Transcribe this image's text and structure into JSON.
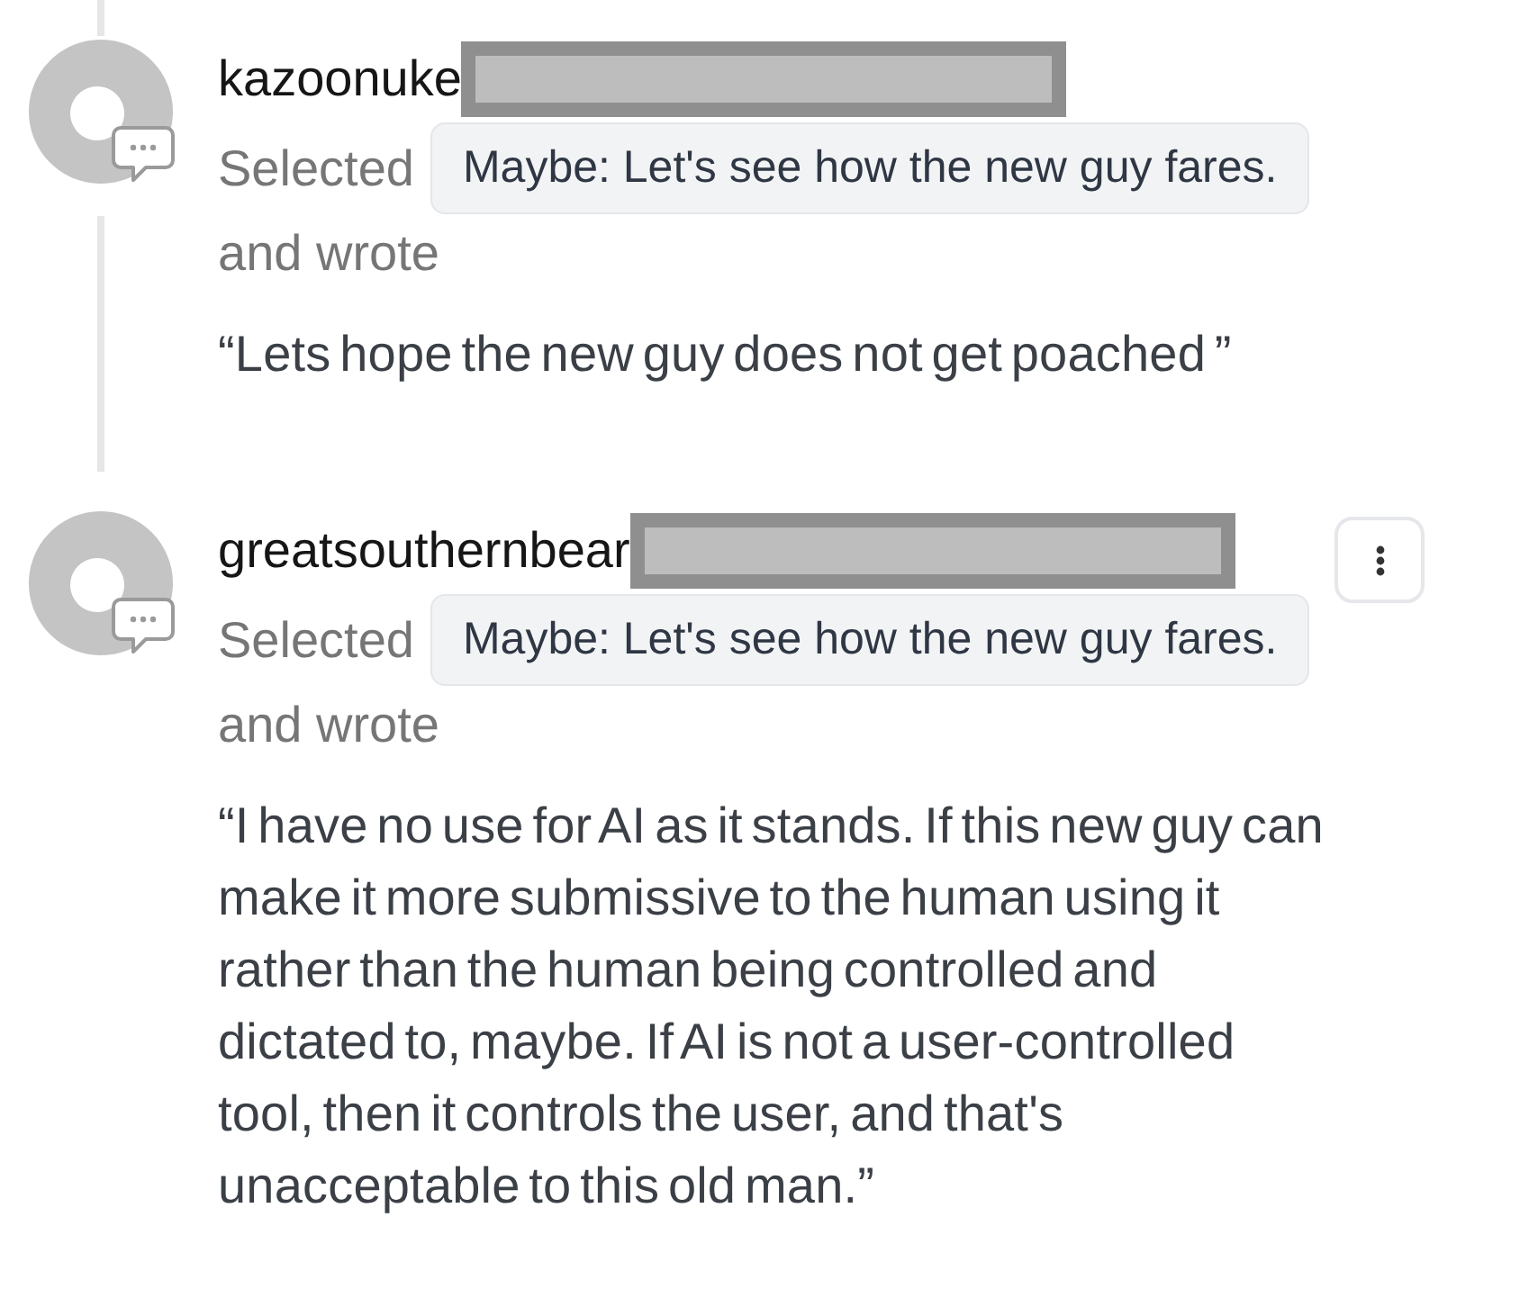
{
  "comments": [
    {
      "username": "kazoonuke",
      "redacted": true,
      "action": "Selected",
      "choice": "Maybe: Let's see how the new guy fares.",
      "connector": "and wrote",
      "text": "“Lets hope the new guy does not get poached ”",
      "menu": false,
      "line_above": true,
      "line_below": true
    },
    {
      "username": "greatsouthernbear",
      "redacted": true,
      "action": "Selected",
      "choice": "Maybe: Let's see how the new guy fares.",
      "connector": "and wrote",
      "text": "“I have no use for AI as it stands. If this new guy can make it more submissive to the human using it rather than the human being controlled and dictated to, maybe. If AI is not a user-controlled tool, then it controls the user, and that's unacceptable to this old man.”",
      "menu": true,
      "line_above": false,
      "line_below": false
    }
  ]
}
